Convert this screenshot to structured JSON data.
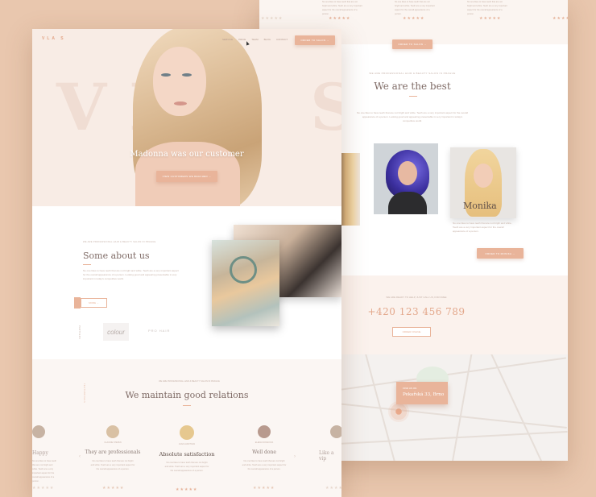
{
  "front": {
    "logo": "VLA S",
    "nav": [
      "SERVICE",
      "PRICE",
      "TEAM",
      "BLOG",
      "CONTACT"
    ],
    "nav_cta": "ORDER TO SALON  →",
    "hero_bg_letters": [
      "V",
      "L",
      "A",
      "S"
    ],
    "hero_title": "Madonna was our customer",
    "hero_button": "VIEW CUSTOMERS WE REACHED  →",
    "about_kicker": "WE ARE PROFESSIONAL HAIR & BEAUTY SALON IN PRAGUE",
    "about_title": "Some about us",
    "about_text": "No one likes to have teeth that are not bright and white. Teeth are a very important aspect for the overall appearance of a person. Looking good and appearing presentable is very important in today's competitive world.",
    "about_button": "MORE  →",
    "partner_label": "PARTNERS",
    "partner_logos": [
      "colour",
      "PRO HAIR"
    ],
    "relations_kicker": "WE ARE PROFESSIONAL HAIR & BEAUTY SALON IN PRAGUE",
    "relations_title": "We maintain good relations",
    "relations_side": "TESTIMONIALS",
    "testimonials": [
      {
        "title": "Happy",
        "name": ""
      },
      {
        "title": "They are professionals",
        "name": "CLAUDIE STEPAN"
      },
      {
        "title": "Absolute satisfaction",
        "name": "JANA JANOTOVA"
      },
      {
        "title": "Well done",
        "name": "ELENA NOVAKOVA"
      },
      {
        "title": "Like a vip",
        "name": ""
      }
    ],
    "testimonial_text": "No one likes to have teeth that are not bright and white. Teeth are a very important aspect for the overall appearance of a person.",
    "stars": "★★★★★"
  },
  "back": {
    "top_stars": "★★★★★",
    "top_button": "ORDER TO SALON  →",
    "best_kicker": "WE ARE PROFESSIONAL HAIR & BEAUTY SALON IN PRAGUE",
    "best_title": "We are the best",
    "best_text": "No one likes to have teeth that are not bright and white. Teeth are a very important aspect for the overall appearance of a person. Looking good and appearing presentable is very important in today's competitive world.",
    "member_name": "Monika",
    "member_text": "No one likes to have teeth that are not bright and white. Teeth are a very important aspect for the overall appearance of a person.",
    "member_button": "ORDER TO MONIKA  →",
    "call_kicker": "WE ARE READY TO HELP, JUST CALL US, FOR FREE",
    "phone": "+420 123 456 789",
    "call_button": "ORDER ONLINE",
    "map_kicker": "FIND US ON",
    "address": "Pekařská 33, Brno"
  },
  "colors": {
    "accent": "#e9b49a",
    "page_bg": "#e9c7ae",
    "hero_bg": "#f8ece5",
    "title": "#7f6b66"
  }
}
